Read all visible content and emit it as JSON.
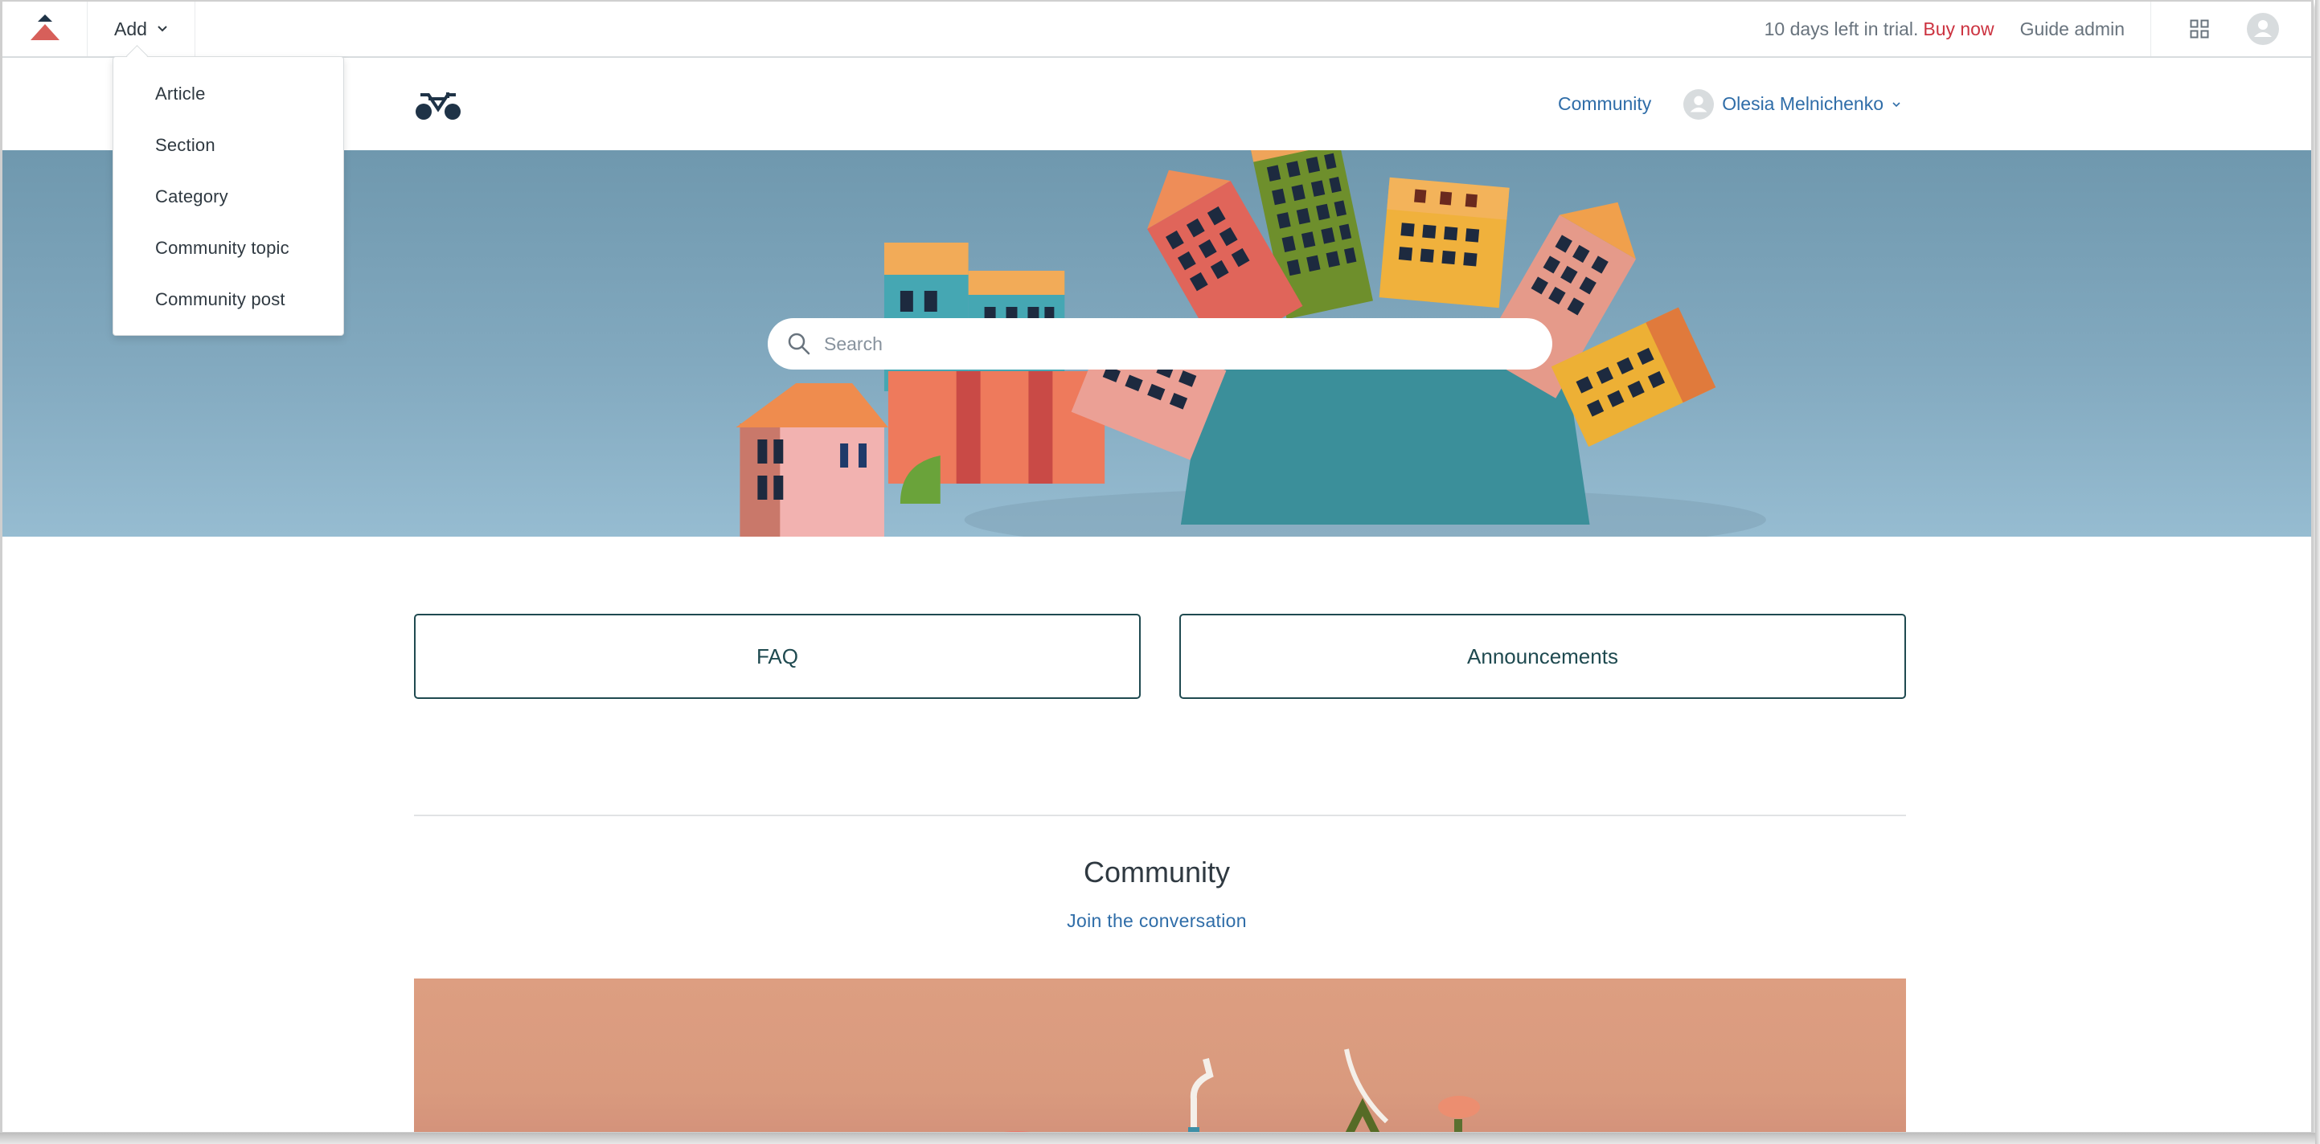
{
  "admin_bar": {
    "logo_icon": "zendesk-guide-logo-icon",
    "add_label": "Add",
    "add_chevron_icon": "chevron-down-icon",
    "trial_text": "10 days left in trial.",
    "buy_now_label": "Buy now",
    "guide_admin_label": "Guide admin",
    "apps_icon": "grid-icon",
    "avatar_icon": "user-avatar-icon",
    "colors": {
      "buy_now": "#cc3340",
      "text": "#68737d"
    }
  },
  "add_menu": {
    "items": [
      {
        "label": "Article"
      },
      {
        "label": "Section"
      },
      {
        "label": "Category"
      },
      {
        "label": "Community topic"
      },
      {
        "label": "Community post"
      }
    ]
  },
  "site_header": {
    "logo_icon": "bicycle-logo-icon",
    "nav_community_label": "Community",
    "user_name": "Olesia Melnichenko",
    "user_chevron_icon": "chevron-down-icon",
    "colors": {
      "link": "#2f6da8"
    }
  },
  "hero": {
    "search": {
      "placeholder": "Search",
      "value": "",
      "icon": "search-icon"
    },
    "image_description": "paper-craft colorful buildings on blue background"
  },
  "blocks": [
    {
      "label": "FAQ"
    },
    {
      "label": "Announcements"
    }
  ],
  "community": {
    "title": "Community",
    "link_label": "Join the conversation",
    "banner_description": "paper-craft bicycles on peach background"
  },
  "colors": {
    "block_border": "#1f4a50",
    "hero_top": "#6f98ae",
    "hero_bottom": "#96bcd1",
    "banner": "#dc9c80"
  }
}
